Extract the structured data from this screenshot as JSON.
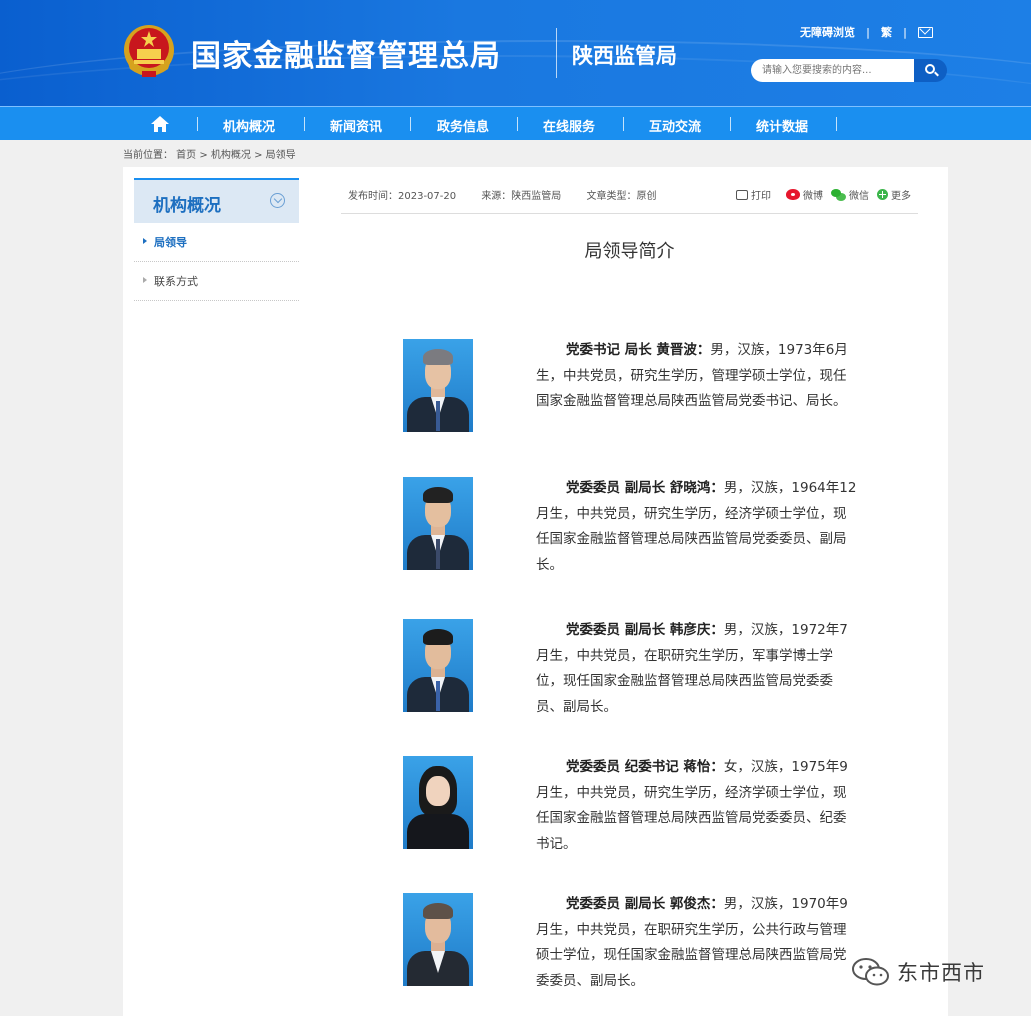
{
  "header": {
    "site_title": "国家金融监督管理总局",
    "sub_title": "陕西监管局",
    "accessible_link": "无障碍浏览",
    "traditional_link": "繁",
    "separator": "|",
    "search_placeholder": "请输入您要搜索的内容..."
  },
  "nav": {
    "items": [
      "机构概况",
      "新闻资讯",
      "政务信息",
      "在线服务",
      "互动交流",
      "统计数据"
    ]
  },
  "breadcrumb": "当前位置： 首页 > 机构概况 > 局领导",
  "sidebar": {
    "title": "机构概况",
    "items": [
      {
        "label": "局领导",
        "active": true
      },
      {
        "label": "联系方式",
        "active": false
      }
    ]
  },
  "article": {
    "publish_time": "发布时间：2023-07-20",
    "source": "来源：陕西监管局",
    "type": "文章类型：原创",
    "share": {
      "print": "打印",
      "weibo": "微博",
      "wechat": "微信",
      "more": "更多"
    },
    "title": "局领导简介",
    "leaders": [
      {
        "role_name": "党委书记 局长 黄晋波：",
        "bio": "男，汉族，1973年6月生，中共党员，研究生学历，管理学硕士学位，现任国家金融监督管理总局陕西监管局党委书记、局长。"
      },
      {
        "role_name": "党委委员 副局长 舒晓鸿：",
        "bio": "男，汉族，1964年12月生，中共党员，研究生学历，经济学硕士学位，现任国家金融监督管理总局陕西监管局党委委员、副局长。"
      },
      {
        "role_name": "党委委员 副局长 韩彦庆：",
        "bio": "男，汉族，1972年7月生，中共党员，在职研究生学历，军事学博士学位，现任国家金融监督管理总局陕西监管局党委委员、副局长。"
      },
      {
        "role_name": "党委委员 纪委书记 蒋怡：",
        "bio": "女，汉族，1975年9月生，中共党员，研究生学历，经济学硕士学位，现任国家金融监督管理总局陕西监管局党委委员、纪委书记。"
      },
      {
        "role_name": "党委委员 副局长 郭俊杰：",
        "bio": "男，汉族，1970年9月生，中共党员，在职研究生学历，公共行政与管理硕士学位，现任国家金融监督管理总局陕西监管局党委委员、副局长。"
      }
    ]
  },
  "watermark": "东市西市",
  "colors": {
    "header_blue": "#1a78e0",
    "nav_blue": "#1a8ff0",
    "sidebar_title": "#1d6fc0"
  }
}
